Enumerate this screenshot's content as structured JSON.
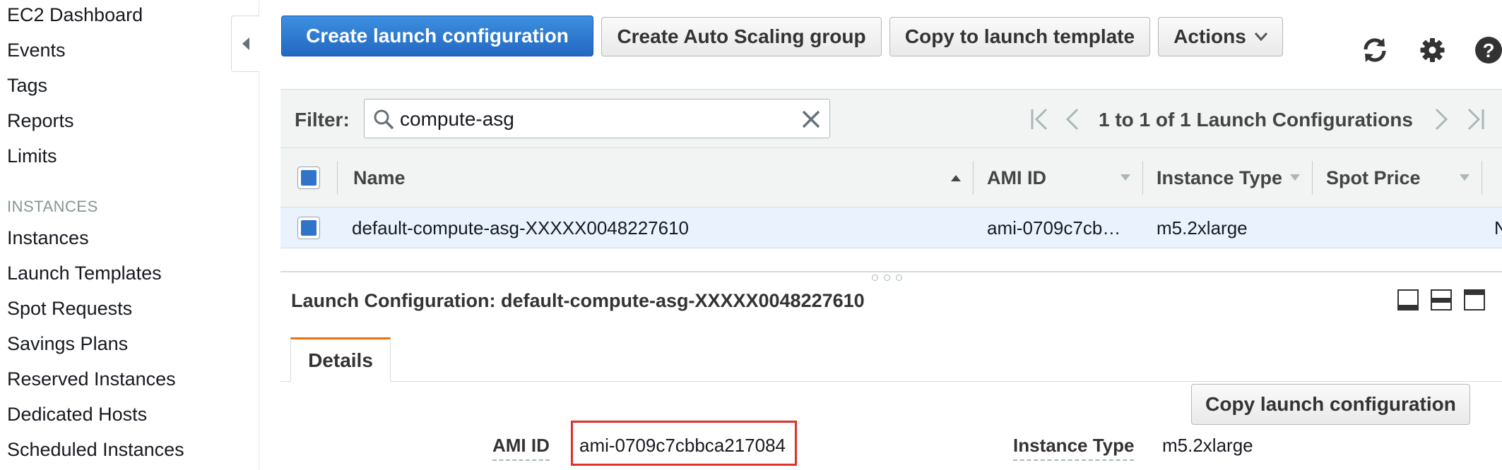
{
  "sidebar": {
    "top_items": [
      "EC2 Dashboard",
      "Events",
      "Tags",
      "Reports",
      "Limits"
    ],
    "section_title": "INSTANCES",
    "instance_items": [
      "Instances",
      "Launch Templates",
      "Spot Requests",
      "Savings Plans",
      "Reserved Instances",
      "Dedicated Hosts",
      "Scheduled Instances"
    ]
  },
  "toolbar": {
    "create_launch_config": "Create launch configuration",
    "create_asg": "Create Auto Scaling group",
    "copy_to_template": "Copy to launch template",
    "actions": "Actions"
  },
  "filter": {
    "label": "Filter:",
    "value": "compute-asg",
    "pagination": "1 to 1 of 1 Launch Configurations"
  },
  "table": {
    "columns": [
      "Name",
      "AMI ID",
      "Instance Type",
      "Spot Price"
    ],
    "rows": [
      {
        "name": "default-compute-asg-XXXXX0048227610",
        "ami_id": "ami-0709c7cb…",
        "instance_type": "m5.2xlarge",
        "spot_price": "",
        "overflow": "N"
      }
    ]
  },
  "details": {
    "title": "Launch Configuration: default-compute-asg-XXXXX0048227610",
    "tab": "Details",
    "copy_button": "Copy launch configuration",
    "ami_label": "AMI ID",
    "ami_value": "ami-0709c7cbbca217084",
    "instance_type_label": "Instance Type",
    "instance_type_value": "m5.2xlarge"
  },
  "colors": {
    "primary": "#2368c2",
    "tab_accent": "#ec7211",
    "highlight": "#e0302a",
    "row_selected": "#eaf3fd"
  }
}
